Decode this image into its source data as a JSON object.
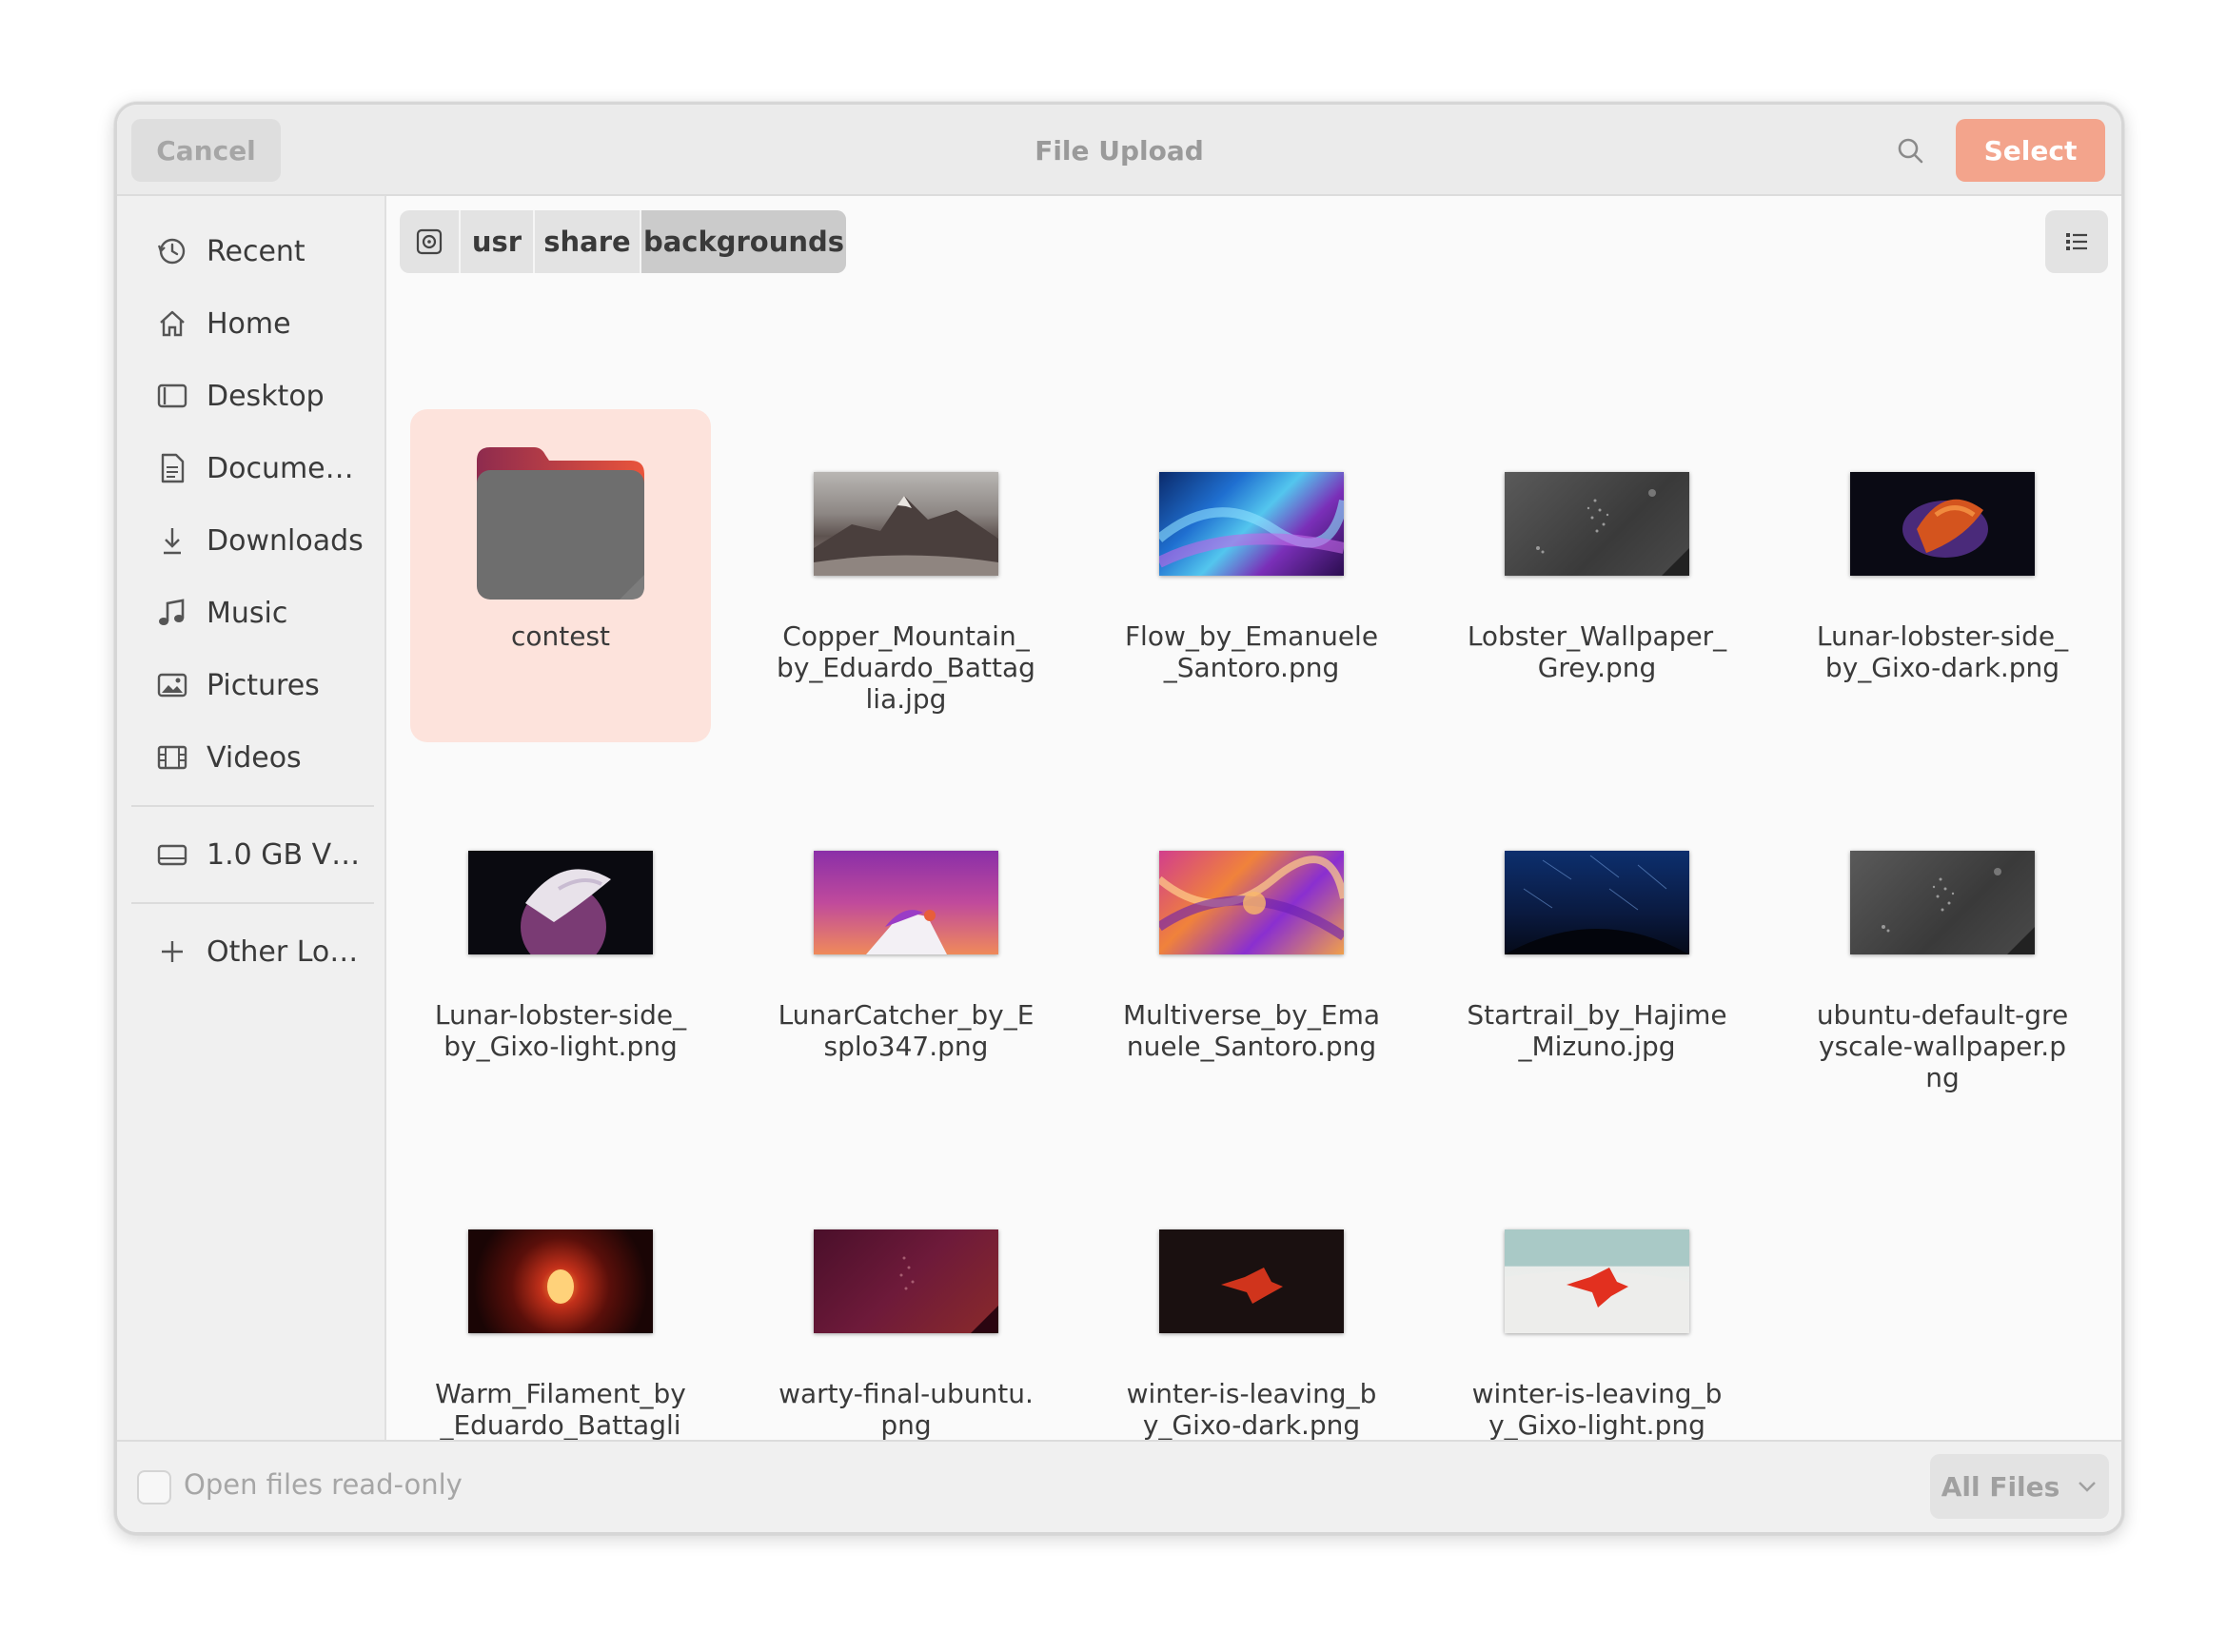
{
  "header": {
    "title": "File Upload",
    "cancel_label": "Cancel",
    "select_label": "Select",
    "search_icon": "search-icon"
  },
  "sidebar": {
    "items": [
      {
        "label": "Recent",
        "icon": "clock-icon"
      },
      {
        "label": "Home",
        "icon": "home-icon"
      },
      {
        "label": "Desktop",
        "icon": "desktop-icon"
      },
      {
        "label": "Docume…",
        "icon": "document-icon"
      },
      {
        "label": "Downloads",
        "icon": "download-icon"
      },
      {
        "label": "Music",
        "icon": "music-icon"
      },
      {
        "label": "Pictures",
        "icon": "pictures-icon"
      },
      {
        "label": "Videos",
        "icon": "video-icon"
      }
    ],
    "drive": {
      "label": "1.0 GB V…",
      "icon": "drive-icon"
    },
    "other": {
      "label": "Other Lo…",
      "icon": "plus-icon"
    }
  },
  "pathbar": {
    "root_icon": "disk-icon",
    "crumbs": [
      "usr",
      "share",
      "backgrounds"
    ]
  },
  "files": [
    {
      "name": "contest",
      "type": "folder",
      "selected": true
    },
    {
      "name": "Copper_Mountain_by_Eduardo_Battaglia.jpg",
      "type": "image"
    },
    {
      "name": "Flow_by_Emanuele_Santoro.png",
      "type": "image"
    },
    {
      "name": "Lobster_Wallpaper_Grey.png",
      "type": "image"
    },
    {
      "name": "Lunar-lobster-side_by_Gixo-dark.png",
      "type": "image"
    },
    {
      "name": "Lunar-lobster-side_by_Gixo-light.png",
      "type": "image"
    },
    {
      "name": "LunarCatcher_by_Esplo347.png",
      "type": "image"
    },
    {
      "name": "Multiverse_by_Emanuele_Santoro.png",
      "type": "image"
    },
    {
      "name": "Startrail_by_Hajime_Mizuno.jpg",
      "type": "image"
    },
    {
      "name": "ubuntu-default-greyscale-wallpaper.png",
      "type": "image"
    },
    {
      "name": "Warm_Filament_by_Eduardo_Battaglia.jpg",
      "type": "image"
    },
    {
      "name": "warty-final-ubuntu.png",
      "type": "image"
    },
    {
      "name": "winter-is-leaving_by_Gixo-dark.png",
      "type": "image"
    },
    {
      "name": "winter-is-leaving_by_Gixo-light.png",
      "type": "image"
    }
  ],
  "footer": {
    "readonly_label": "Open files read-only",
    "readonly_checked": false,
    "filter_label": "All Files"
  },
  "colors": {
    "accent": "#f3a48c",
    "selection": "#fde3dc"
  }
}
